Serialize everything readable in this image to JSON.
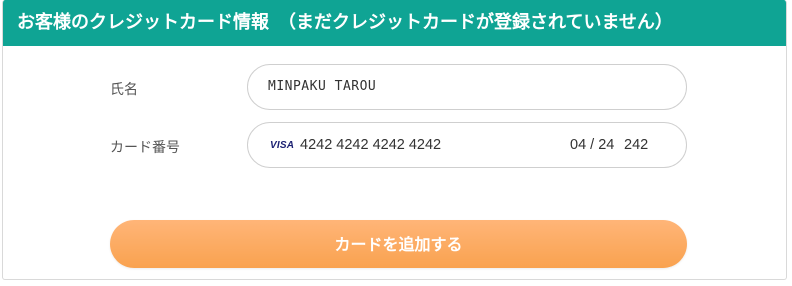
{
  "header": {
    "title": "お客様のクレジットカード情報　（まだクレジットカードが登録されていません）"
  },
  "form": {
    "name_label": "氏名",
    "name_value": "MINPAKU TAROU",
    "card_label": "カード番号",
    "card_brand": "VISA",
    "card_number": "4242 4242 4242 4242",
    "card_expiry": "04 / 24",
    "card_cvc": "242"
  },
  "actions": {
    "add_card_label": "カードを追加する"
  },
  "colors": {
    "header_bg": "#0fa494",
    "button_bg": "#f9a24f",
    "brand_visa": "#1a1f71"
  },
  "icons": {
    "card_brand_icon": "visa-icon"
  }
}
